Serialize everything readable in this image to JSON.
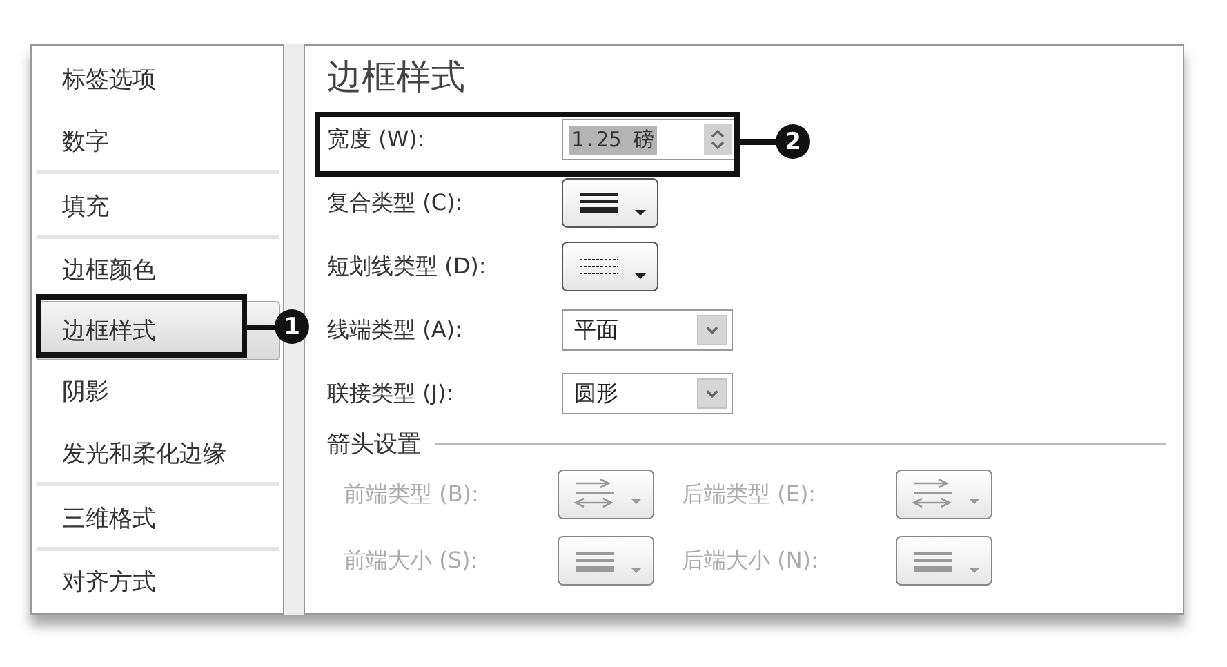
{
  "sidebar": {
    "items": [
      {
        "label": "标签选项",
        "selected": false,
        "divider_after": false
      },
      {
        "label": "数字",
        "selected": false,
        "divider_after": true
      },
      {
        "label": "填充",
        "selected": false,
        "divider_after": true
      },
      {
        "label": "边框颜色",
        "selected": false,
        "divider_after": false
      },
      {
        "label": "边框样式",
        "selected": true,
        "divider_after": false
      },
      {
        "label": "阴影",
        "selected": false,
        "divider_after": false
      },
      {
        "label": "发光和柔化边缘",
        "selected": false,
        "divider_after": true
      },
      {
        "label": "三维格式",
        "selected": false,
        "divider_after": true
      },
      {
        "label": "对齐方式",
        "selected": false,
        "divider_after": false
      }
    ]
  },
  "panel": {
    "title": "边框样式",
    "fields": [
      {
        "kind": "spinner",
        "label": "宽度 (W):",
        "value": "1.25 磅"
      },
      {
        "kind": "compound",
        "label": "复合类型 (C):"
      },
      {
        "kind": "dash",
        "label": "短划线类型 (D):"
      },
      {
        "kind": "combo",
        "label": "线端类型 (A):",
        "value": "平面"
      },
      {
        "kind": "combo",
        "label": "联接类型 (J):",
        "value": "圆形"
      }
    ],
    "arrows": {
      "title": "箭头设置",
      "disabled": true,
      "rows": [
        [
          {
            "kind": "arrow",
            "label": "前端类型 (B):"
          },
          {
            "kind": "arrow",
            "label": "后端类型 (E):"
          }
        ],
        [
          {
            "kind": "size",
            "label": "前端大小 (S):"
          },
          {
            "kind": "size",
            "label": "后端大小 (N):"
          }
        ]
      ]
    }
  },
  "callouts": [
    {
      "label": "1"
    },
    {
      "label": "2"
    }
  ]
}
